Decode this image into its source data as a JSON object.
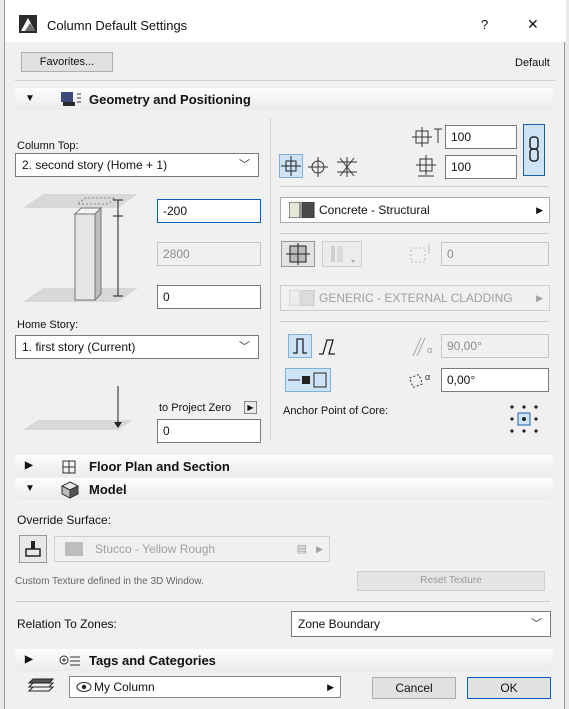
{
  "window": {
    "title": "Column Default Settings",
    "help_label": "?",
    "close_label": "✕"
  },
  "toolbar": {
    "favorites_label": "Favorites...",
    "default_label": "Default"
  },
  "geometry": {
    "section_title": "Geometry and Positioning",
    "column_top_label": "Column Top:",
    "column_top_value": "2. second story (Home + 1)",
    "top_offset_value": "-200",
    "height_value": "2800",
    "bottom_offset_value": "0",
    "home_story_label": "Home Story:",
    "home_story_value": "1. first story (Current)",
    "to_project_zero_label": "to Project Zero",
    "project_zero_value": "0",
    "width_value": "100",
    "depth_value": "100",
    "core_material": "Concrete - Structural",
    "veneer_thickness_value": "0",
    "veneer_material": "GENERIC - EXTERNAL CLADDING",
    "slant_angle_value": "90,00°",
    "rotation_angle_value": "0,00°",
    "anchor_point_label": "Anchor Point of Core:"
  },
  "floorplan": {
    "section_title": "Floor Plan and Section"
  },
  "model": {
    "section_title": "Model",
    "override_surface_label": "Override Surface:",
    "surface_value": "Stucco - Yellow Rough",
    "texture_note": "Custom Texture defined in the 3D Window.",
    "reset_texture_label": "Reset Texture",
    "relation_label": "Relation To Zones:",
    "relation_value": "Zone Boundary"
  },
  "tags": {
    "section_title": "Tags and Categories"
  },
  "footer": {
    "favorite_name": "My Column",
    "cancel_label": "Cancel",
    "ok_label": "OK"
  },
  "colors": {
    "accent": "#0a5fc4",
    "toggle_bg": "#cfe3f7",
    "window_bg": "#f0f0f0"
  }
}
